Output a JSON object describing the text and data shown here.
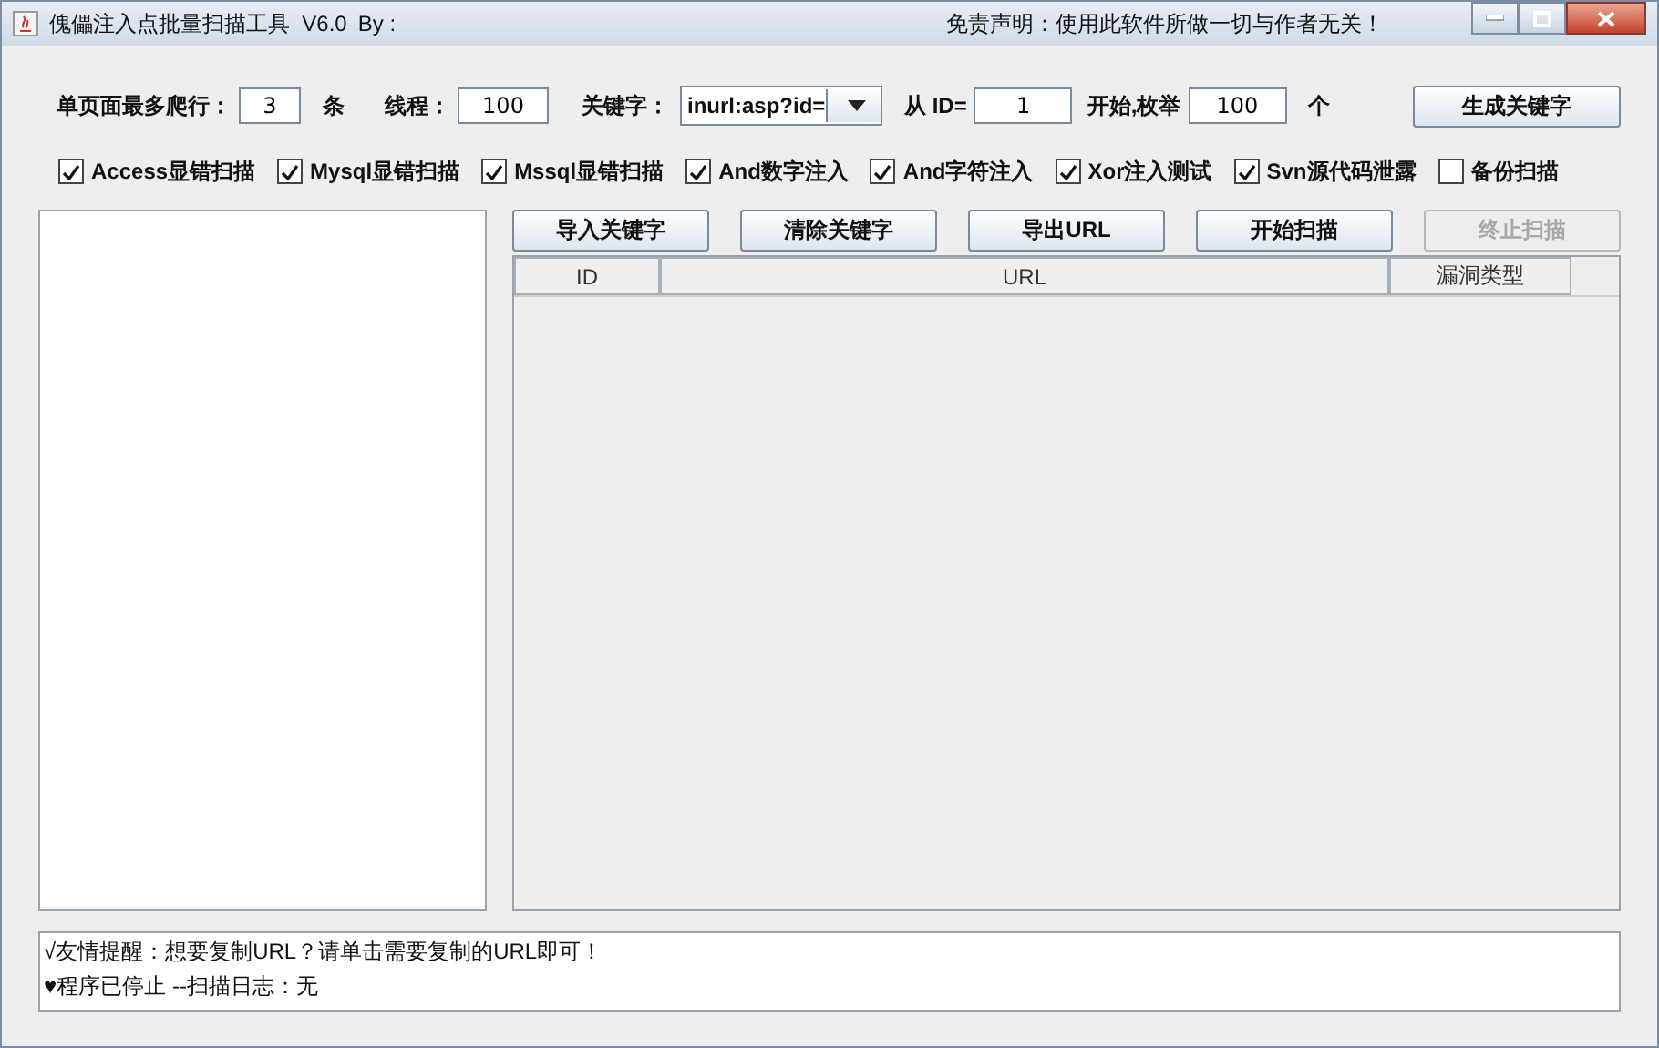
{
  "window": {
    "title": "傀儡注入点批量扫描工具  V6.0",
    "author_label": "By :",
    "disclaimer": "免责声明：使用此软件所做一切与作者无关！"
  },
  "settings": [
    {
      "kind": "field",
      "label": "单页面最多爬行：",
      "value": "3",
      "unit": "条"
    },
    {
      "kind": "field",
      "label": "线程：",
      "value": "100"
    },
    {
      "kind": "dropdown",
      "label": "关键字：",
      "value": "inurl:asp?id="
    },
    {
      "kind": "field",
      "label": "从 ID=",
      "value": "1"
    },
    {
      "kind": "field",
      "label": "开始,枚举",
      "value": "100",
      "unit": "个"
    }
  ],
  "generate_button": "生成关键字",
  "options": [
    {
      "label": "Access显错扫描",
      "checked": true
    },
    {
      "label": "Mysql显错扫描",
      "checked": true
    },
    {
      "label": "Mssql显错扫描",
      "checked": true
    },
    {
      "label": "And数字注入",
      "checked": true
    },
    {
      "label": "And字符注入",
      "checked": true
    },
    {
      "label": "Xor注入测试",
      "checked": true
    },
    {
      "label": "Svn源代码泄露",
      "checked": true
    },
    {
      "label": "备份扫描",
      "checked": false
    }
  ],
  "buttons": [
    {
      "label": "导入关键字",
      "disabled": false
    },
    {
      "label": "清除关键字",
      "disabled": false
    },
    {
      "label": "导出URL",
      "disabled": false
    },
    {
      "label": "开始扫描",
      "disabled": false
    },
    {
      "label": "终止扫描",
      "disabled": true
    }
  ],
  "table": {
    "columns": [
      "ID",
      "URL",
      "漏洞类型"
    ]
  },
  "log": [
    "√友情提醒：想要复制URL？请单击需要复制的URL即可！",
    "♥程序已停止 --扫描日志：无"
  ]
}
